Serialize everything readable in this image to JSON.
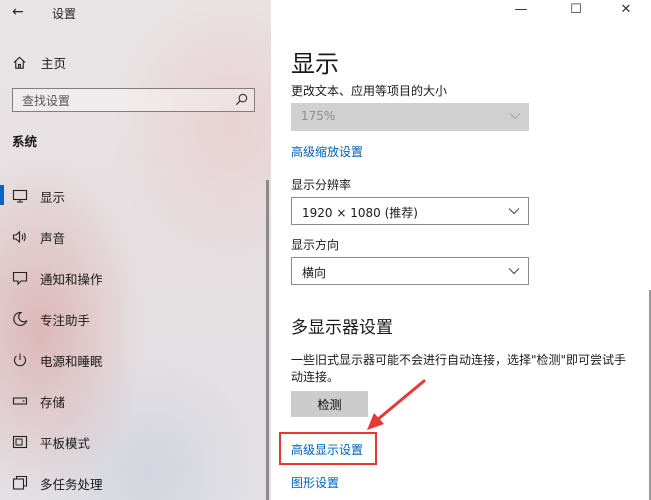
{
  "window": {
    "title": "设置",
    "back_glyph": "←",
    "minimize_glyph": "—",
    "maximize_glyph": "☐",
    "close_glyph": "✕"
  },
  "sidebar": {
    "home_label": "主页",
    "search_placeholder": "查找设置",
    "section": "系统",
    "items": [
      {
        "label": "显示",
        "icon": "monitor-icon",
        "active": true
      },
      {
        "label": "声音",
        "icon": "speaker-icon",
        "active": false
      },
      {
        "label": "通知和操作",
        "icon": "notification-icon",
        "active": false
      },
      {
        "label": "专注助手",
        "icon": "moon-icon",
        "active": false
      },
      {
        "label": "电源和睡眠",
        "icon": "power-icon",
        "active": false
      },
      {
        "label": "存储",
        "icon": "storage-icon",
        "active": false
      },
      {
        "label": "平板模式",
        "icon": "tablet-icon",
        "active": false
      },
      {
        "label": "多任务处理",
        "icon": "multitask-icon",
        "active": false
      }
    ]
  },
  "main": {
    "title": "显示",
    "scale_label": "更改文本、应用等项目的大小",
    "scale_value": "175%",
    "advanced_scaling_link": "高级缩放设置",
    "resolution_label": "显示分辨率",
    "resolution_value": "1920 × 1080 (推荐)",
    "orientation_label": "显示方向",
    "orientation_value": "横向",
    "multi_display_heading": "多显示器设置",
    "multi_display_desc": "一些旧式显示器可能不会进行自动连接，选择\"检测\"即可尝试手动连接。",
    "detect_button": "检测",
    "advanced_display_link": "高级显示设置",
    "graphics_link": "图形设置"
  },
  "colors": {
    "accent": "#0067c0",
    "link": "#0060b8",
    "annotation": "#e53935"
  }
}
